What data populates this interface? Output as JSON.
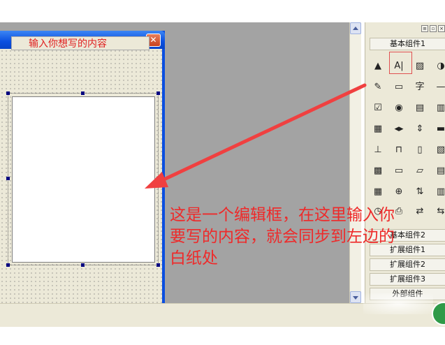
{
  "form": {
    "label_text": "输入你想写的内容",
    "close_glyph": "✕"
  },
  "toolbox": {
    "title_buttons": [
      "≡",
      "▫",
      "×"
    ],
    "categories": {
      "basic": "基本组件1",
      "basic2": "基本组件2",
      "ext1": "扩展组件1",
      "ext2": "扩展组件2",
      "ext3": "扩展组件3",
      "external": "外部组件"
    },
    "tools": [
      {
        "name": "pointer-tool-icon",
        "glyph": "▲"
      },
      {
        "name": "edit-box-tool-icon",
        "glyph": "A|"
      },
      {
        "name": "picture-tool-icon",
        "glyph": "▨"
      },
      {
        "name": "shape-tool-icon",
        "glyph": "◑"
      },
      {
        "name": "pen-tool-icon",
        "glyph": "✎"
      },
      {
        "name": "button-tool-icon",
        "glyph": "▭"
      },
      {
        "name": "label-tool-icon",
        "glyph": "字"
      },
      {
        "name": "line-tool-icon",
        "glyph": "—"
      },
      {
        "name": "checkbox-tool-icon",
        "glyph": "☑"
      },
      {
        "name": "radio-tool-icon",
        "glyph": "◉"
      },
      {
        "name": "listbox-tool-icon",
        "glyph": "▤"
      },
      {
        "name": "combo-tool-icon",
        "glyph": "▥"
      },
      {
        "name": "grid-tool-icon",
        "glyph": "▦"
      },
      {
        "name": "hscroll-tool-icon",
        "glyph": "◂▸"
      },
      {
        "name": "spinner-tool-icon",
        "glyph": "⇕"
      },
      {
        "name": "progress-tool-icon",
        "glyph": "▬"
      },
      {
        "name": "slider-tool-icon",
        "glyph": "⊥"
      },
      {
        "name": "tab-tool-icon",
        "glyph": "⊓"
      },
      {
        "name": "frame-tool-icon",
        "glyph": "▯"
      },
      {
        "name": "image-list-tool-icon",
        "glyph": "▧"
      },
      {
        "name": "calendar-tool-icon",
        "glyph": "▩"
      },
      {
        "name": "status-bar-tool-icon",
        "glyph": "▭"
      },
      {
        "name": "dir-tool-icon",
        "glyph": "▱"
      },
      {
        "name": "file-tool-icon",
        "glyph": "▤"
      },
      {
        "name": "color-tool-icon",
        "glyph": "▦"
      },
      {
        "name": "network-tool-icon",
        "glyph": "⊕"
      },
      {
        "name": "range-tool-icon",
        "glyph": "⇅"
      },
      {
        "name": "table-tool-icon",
        "glyph": "▥"
      },
      {
        "name": "timer-tool-icon",
        "glyph": "◷"
      },
      {
        "name": "printer-tool-icon",
        "glyph": "⎙"
      },
      {
        "name": "sync-tool-icon",
        "glyph": "⇄"
      },
      {
        "name": "swap-tool-icon",
        "glyph": "⇆"
      }
    ]
  },
  "annotation": {
    "line1": "这是一个编辑框，在这里输入你",
    "line2": "要写的内容，就会同步到左边的",
    "line3": "白纸处",
    "color": "#ee2a2a"
  }
}
